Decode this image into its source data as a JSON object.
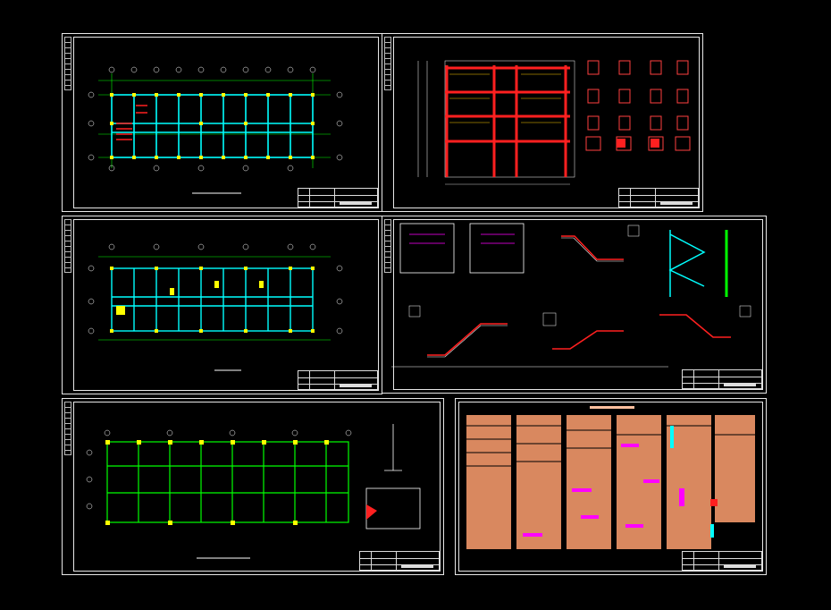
{
  "window": {
    "title": "",
    "background": "#000000"
  },
  "colors": {
    "beam": "#00ffff",
    "axis": "#00ff00",
    "column": "#ffff00",
    "rebar": "#ff0000",
    "text": "#ffffff",
    "hatch": "#ff00ff",
    "notes": "#ffa070"
  },
  "sheets": [
    {
      "id": "floor-plan-1",
      "caption": "",
      "sheet_no": ""
    },
    {
      "id": "frame-elevation",
      "caption": "",
      "sheet_no": ""
    },
    {
      "id": "floor-plan-2",
      "caption": "",
      "sheet_no": ""
    },
    {
      "id": "stair-details",
      "caption": "",
      "sheet_no": ""
    },
    {
      "id": "foundation-plan",
      "caption": "",
      "sheet_no": ""
    },
    {
      "id": "structural-notes",
      "caption": "",
      "sheet_no": ""
    }
  ]
}
